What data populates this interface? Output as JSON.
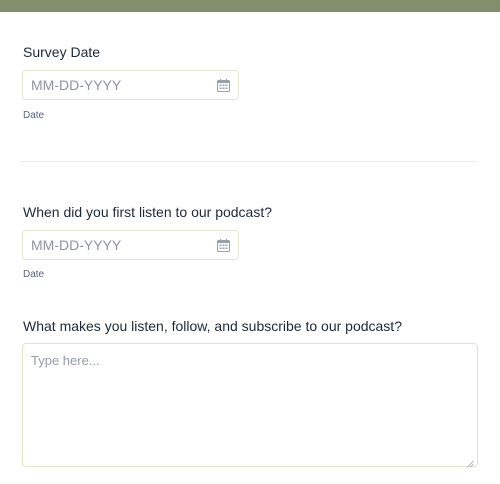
{
  "colors": {
    "header_bar": "#838e6c",
    "field_border": "#e4e6cf",
    "label_text": "#1f2937",
    "placeholder_text": "#8e939f"
  },
  "form": {
    "survey_date": {
      "label": "Survey Date",
      "placeholder": "MM-DD-YYYY",
      "sublabel": "Date",
      "icon": "calendar-icon"
    },
    "first_listen": {
      "label": "When did you first listen to our podcast?",
      "placeholder": "MM-DD-YYYY",
      "sublabel": "Date",
      "icon": "calendar-icon"
    },
    "reason": {
      "label": "What makes you listen, follow, and subscribe to our podcast?",
      "placeholder": "Type here..."
    }
  }
}
